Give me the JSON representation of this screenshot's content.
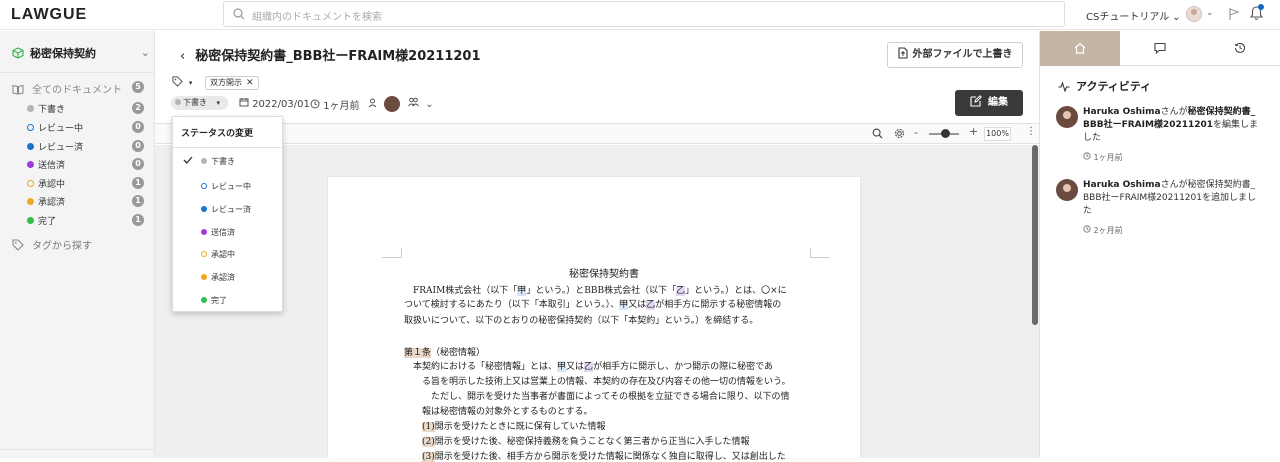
{
  "app": {
    "logo": "LAWGUE"
  },
  "search": {
    "placeholder": "組織内のドキュメントを検索"
  },
  "org": {
    "name": "CSチュートリアル"
  },
  "sidebar": {
    "workspace": "秘密保持契約",
    "all_docs": {
      "label": "全てのドキュメント",
      "count": "5"
    },
    "statuses": [
      {
        "label": "下書き",
        "count": "2",
        "color": "#b5b5b5",
        "ring": false
      },
      {
        "label": "レビュー中",
        "count": "0",
        "color": "#1a73c9",
        "ring": true
      },
      {
        "label": "レビュー済",
        "count": "0",
        "color": "#1a73c9",
        "ring": false
      },
      {
        "label": "送信済",
        "count": "0",
        "color": "#9b3be0",
        "ring": false
      },
      {
        "label": "承認中",
        "count": "1",
        "color": "#f0a81c",
        "ring": true
      },
      {
        "label": "承認済",
        "count": "1",
        "color": "#f0a81c",
        "ring": false
      },
      {
        "label": "完了",
        "count": "1",
        "color": "#2fbf4c",
        "ring": false
      }
    ],
    "tag_search": "タグから探す"
  },
  "document": {
    "title": "秘密保持契約書_BBB社ーFRAIM様20211201",
    "external_button": "外部ファイルで上書き",
    "tag": "双方開示",
    "status": "下書き",
    "date": "2022/03/01",
    "updated": "1ヶ月前",
    "edit_button": "編集",
    "zoom": "100%",
    "zoom_minus": "-",
    "zoom_plus": "+"
  },
  "status_menu": {
    "title": "ステータスの変更",
    "selected": "下書き",
    "items": [
      "下書き",
      "レビュー中",
      "レビュー済",
      "送信済",
      "承認中",
      "承認済",
      "完了"
    ]
  },
  "contract": {
    "heading": "秘密保持契約書",
    "intro": [
      {
        "pre": "　FRAIM株式会社（以下「",
        "a": "甲",
        "mid": "」という。）とBBB株式会社（以下「",
        "b": "乙",
        "post": "」という。）とは、〇×に"
      },
      {
        "text": "ついて検討するにあたり（以下「本取引」という。）、",
        "a": "甲",
        "or": "又は",
        "b": "乙",
        "post": "が相手方に開示する秘密情報の"
      },
      {
        "text": "取扱いについて、以下のとおりの秘密保持契約（以下「本契約」という。）を締結する。"
      }
    ],
    "article1": {
      "num": "第１条",
      "title": "（秘密情報）"
    },
    "body": [
      {
        "pre": "　本契約における「秘密情報」とは、",
        "a": "甲",
        "or": "又は",
        "b": "乙",
        "post": "が相手方に開示し、かつ開示の際に秘密であ"
      },
      {
        "text": "る旨を明示した技術上又は営業上の情報、本契約の存在及び内容その他一切の情報をいう。"
      },
      {
        "text": "　ただし、開示を受けた当事者が書面によってその根拠を立証できる場合に限り、以下の情"
      },
      {
        "text": "報は秘密情報の対象外とするものとする。"
      }
    ],
    "items": [
      {
        "num": "(1)",
        "text": "開示を受けたときに既に保有していた情報"
      },
      {
        "num": "(2)",
        "text": "開示を受けた後、秘密保持義務を負うことなく第三者から正当に入手した情報"
      },
      {
        "num": "(3)",
        "text": "開示を受けた後、相手方から開示を受けた情報に関係なく独自に取得し、又は創出した"
      }
    ]
  },
  "right_panel": {
    "heading": "アクティビティ",
    "activities": [
      {
        "user": "Haruka Oshima",
        "pre": "さんが",
        "doc": "秘密保持契約書_BBB社ーFRAIM様20211201",
        "post": "を編集しました",
        "time": "1ヶ月前"
      },
      {
        "user": "Haruka Oshima",
        "pre": "さんが",
        "doc": "秘密保持契約書_BBB社ーFRAIM様20211201",
        "post": "を追加しました",
        "time": "2ヶ月前"
      }
    ]
  }
}
